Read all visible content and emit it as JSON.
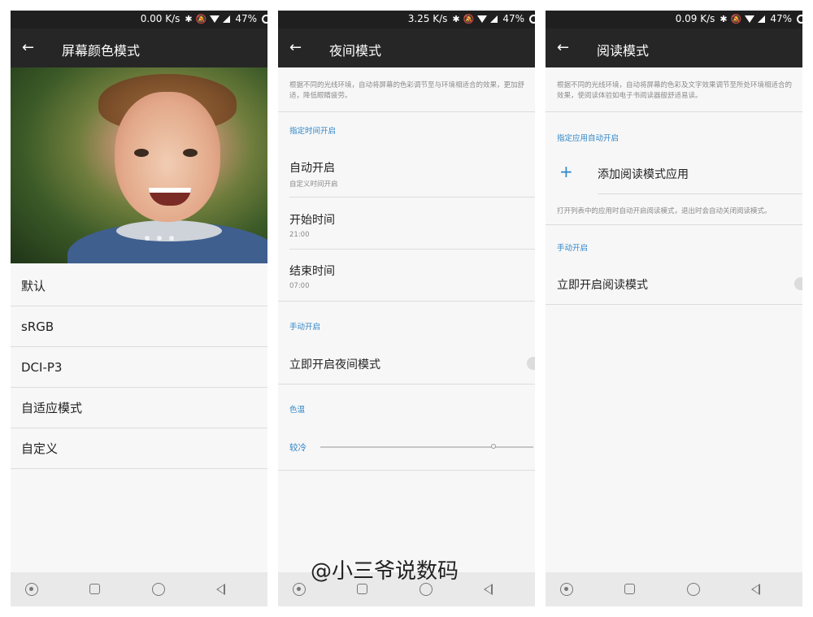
{
  "panel1": {
    "status": {
      "speed": "0.00 K/s",
      "battery": "47%"
    },
    "toolbar": {
      "title": "屏幕颜色模式"
    },
    "options": [
      "默认",
      "sRGB",
      "DCI-P3",
      "自适应模式",
      "自定义"
    ]
  },
  "panel2": {
    "status": {
      "speed": "3.25 K/s",
      "battery": "47%"
    },
    "toolbar": {
      "title": "夜间模式"
    },
    "description": "根据不同的光线环境，自动将屏幕的色彩调节至与环境相适合的效果，更加舒适，降低眼睛疲劳。",
    "section_scheduled": "指定时间开启",
    "auto_on": {
      "title": "自动开启",
      "subtitle": "自定义时间开启"
    },
    "start_time": {
      "title": "开始时间",
      "value": "21:00"
    },
    "end_time": {
      "title": "结束时间",
      "value": "07:00"
    },
    "section_manual": "手动开启",
    "manual_toggle_label": "立即开启夜间模式",
    "section_temp": "色温",
    "temp_label": "较冷"
  },
  "panel3": {
    "status": {
      "speed": "0.09 K/s",
      "battery": "47%"
    },
    "toolbar": {
      "title": "阅读模式"
    },
    "description": "根据不同的光线环境，自动将屏幕的色彩及文字效果调节至所处环境相适合的效果，使阅读体验如电子书阅读器般舒适易读。",
    "section_apps": "指定应用自动开启",
    "add_app_label": "添加阅读模式应用",
    "apps_hint": "打开列表中的应用时自动开启阅读模式，退出时会自动关闭阅读模式。",
    "section_manual": "手动开启",
    "manual_toggle_label": "立即开启阅读模式"
  },
  "watermark": "@小三爷说数码",
  "colors": {
    "accent": "#2f86c8",
    "toolbar": "#262626",
    "statusbar": "#1f1f1f",
    "background": "#f7f7f7"
  },
  "icons": {
    "back": "arrow-left-icon",
    "nav": [
      "dot-icon",
      "square-icon",
      "circle-icon",
      "triangle-back-icon"
    ]
  }
}
